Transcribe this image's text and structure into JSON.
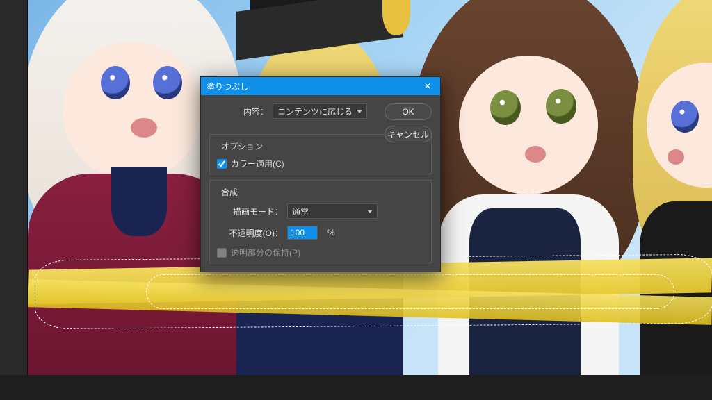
{
  "dialog": {
    "title": "塗りつぶし",
    "content_label": "内容：",
    "content_value": "コンテンツに応じる",
    "ok_label": "OK",
    "cancel_label": "キャンセル",
    "options_legend": "オプション",
    "color_adapt_label": "カラー適用(C)",
    "color_adapt_checked": true,
    "blend_legend": "合成",
    "mode_label": "描画モード：",
    "mode_value": "通常",
    "opacity_label": "不透明度(O)：",
    "opacity_value": "100",
    "opacity_unit": "%",
    "preserve_label": "透明部分の保持(P)",
    "preserve_checked": false
  }
}
